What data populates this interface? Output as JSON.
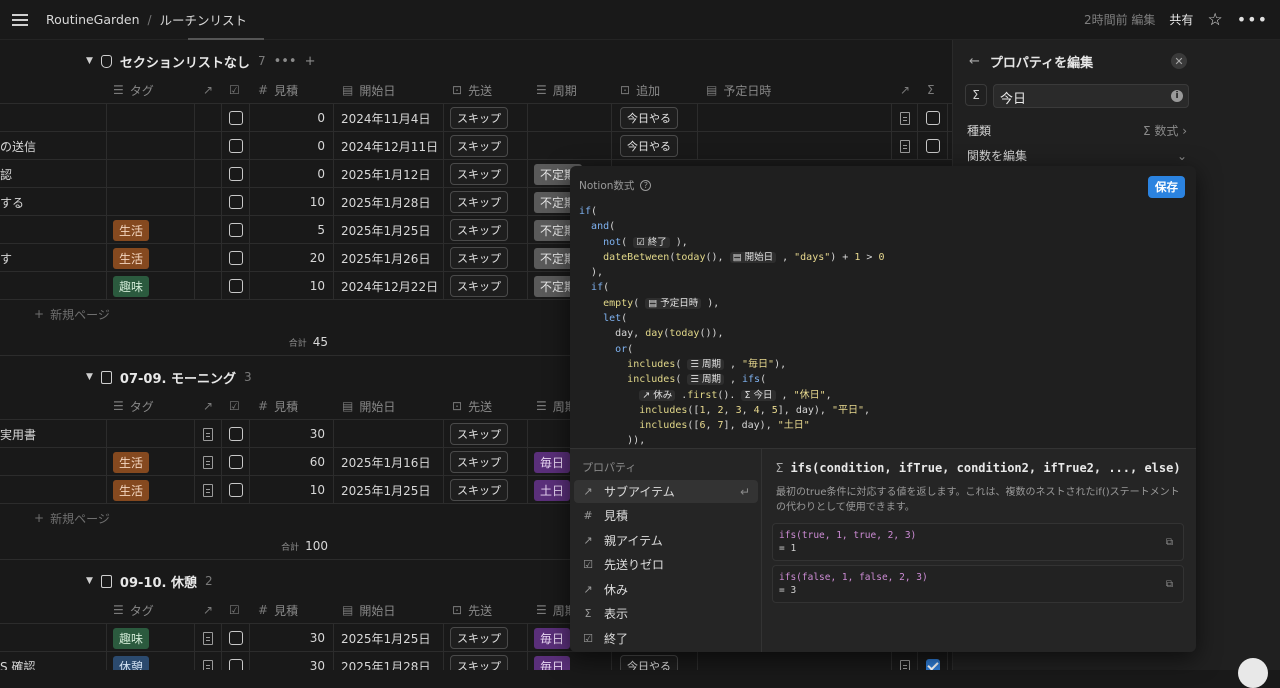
{
  "topbar": {
    "workspace": "RoutineGarden",
    "separator": "/",
    "page": "ルーチンリスト",
    "edited": "2時間前 編集",
    "share": "共有"
  },
  "columns": {
    "tag": "タグ",
    "estimate": "見積",
    "start": "開始日",
    "skip": "先送",
    "cycle": "周期",
    "add": "追加",
    "planned": "予定日時"
  },
  "groups": [
    {
      "title": "セクションリストなし",
      "count": "7",
      "new_page": "新規ページ",
      "sum_label": "合計",
      "sum": "45",
      "rows": [
        {
          "name": "",
          "tag": "",
          "estimate": "0",
          "start": "2024年11月4日",
          "skip": "スキップ",
          "cycle": "",
          "add": "今日やる"
        },
        {
          "name": "の送信",
          "tag": "",
          "estimate": "0",
          "start": "2024年12月11日",
          "skip": "スキップ",
          "cycle": "",
          "add": "今日やる"
        },
        {
          "name": "認",
          "tag": "",
          "estimate": "0",
          "start": "2025年1月12日",
          "skip": "スキップ",
          "cycle": "不定期",
          "add": ""
        },
        {
          "name": "する",
          "tag": "",
          "estimate": "10",
          "start": "2025年1月28日",
          "skip": "スキップ",
          "cycle": "不定期",
          "add": ""
        },
        {
          "name": "",
          "tag": "生活",
          "estimate": "5",
          "start": "2025年1月25日",
          "skip": "スキップ",
          "cycle": "不定期",
          "add": ""
        },
        {
          "name": "す",
          "tag": "生活",
          "estimate": "20",
          "start": "2025年1月26日",
          "skip": "スキップ",
          "cycle": "不定期",
          "add": ""
        },
        {
          "name": "",
          "tag": "趣味",
          "estimate": "10",
          "start": "2024年12月22日",
          "skip": "スキップ",
          "cycle": "不定期",
          "add": ""
        }
      ]
    },
    {
      "title": "07-09. モーニング",
      "count": "3",
      "new_page": "新規ページ",
      "sum_label": "合計",
      "sum": "100",
      "rows": [
        {
          "name": "実用書",
          "tag": "",
          "estimate": "30",
          "start": "",
          "skip": "スキップ",
          "cycle": ""
        },
        {
          "name": "",
          "tag": "生活",
          "estimate": "60",
          "start": "2025年1月16日",
          "skip": "スキップ",
          "cycle": "毎日"
        },
        {
          "name": "",
          "tag": "生活",
          "estimate": "10",
          "start": "2025年1月25日",
          "skip": "スキップ",
          "cycle": "土日"
        }
      ]
    },
    {
      "title": "09-10. 休憩",
      "count": "2",
      "rows": [
        {
          "name": "",
          "tag": "趣味",
          "estimate": "30",
          "start": "2025年1月25日",
          "skip": "スキップ",
          "cycle": "毎日",
          "add": ""
        },
        {
          "name": "S 確認",
          "tag": "休憩",
          "estimate": "30",
          "start": "2025年1月28日",
          "skip": "スキップ",
          "cycle": "毎日",
          "add": "今日やる"
        }
      ]
    }
  ],
  "right_panel": {
    "title": "プロパティを編集",
    "name_value": "今日",
    "type_label": "種類",
    "type_value": "数式",
    "edit_formula": "関数を編集"
  },
  "formula": {
    "title": "Notion数式",
    "save": "保存",
    "props_header": "プロパティ",
    "properties": [
      "サブアイテム",
      "見積",
      "親アイテム",
      "先送りゼロ",
      "休み",
      "表示",
      "終了"
    ],
    "doc_signature": "ifs(condition, ifTrue, condition2, ifTrue2, ..., else)",
    "doc_description": "最初のtrue条件に対応する値を返します。これは、複数のネストされたif()ステートメントの代わりとして使用できます。",
    "example1_code": "ifs(true, 1, true, 2, 3)",
    "example1_result": "= 1",
    "example2_code": "ifs(false, 1, false, 2, 3)",
    "example2_result": "= 3",
    "pills": {
      "done": "終了",
      "start": "開始日",
      "planned": "予定日時",
      "cycle": "周期",
      "rest": "休み",
      "today": "今日"
    },
    "strings": {
      "days": "\"days\"",
      "everyday": "\"毎日\"",
      "holiday": "\"休日\"",
      "weekday": "\"平日\"",
      "weekend": "\"土日\""
    }
  },
  "colors": {
    "accent": "#2b83e0",
    "tag_life": "#85491f",
    "tag_hobby": "#2b5a3e",
    "tag_rest": "#2b4a6e",
    "tag_irregular": "#5a5a5a",
    "tag_daily": "#5a2f7a"
  }
}
